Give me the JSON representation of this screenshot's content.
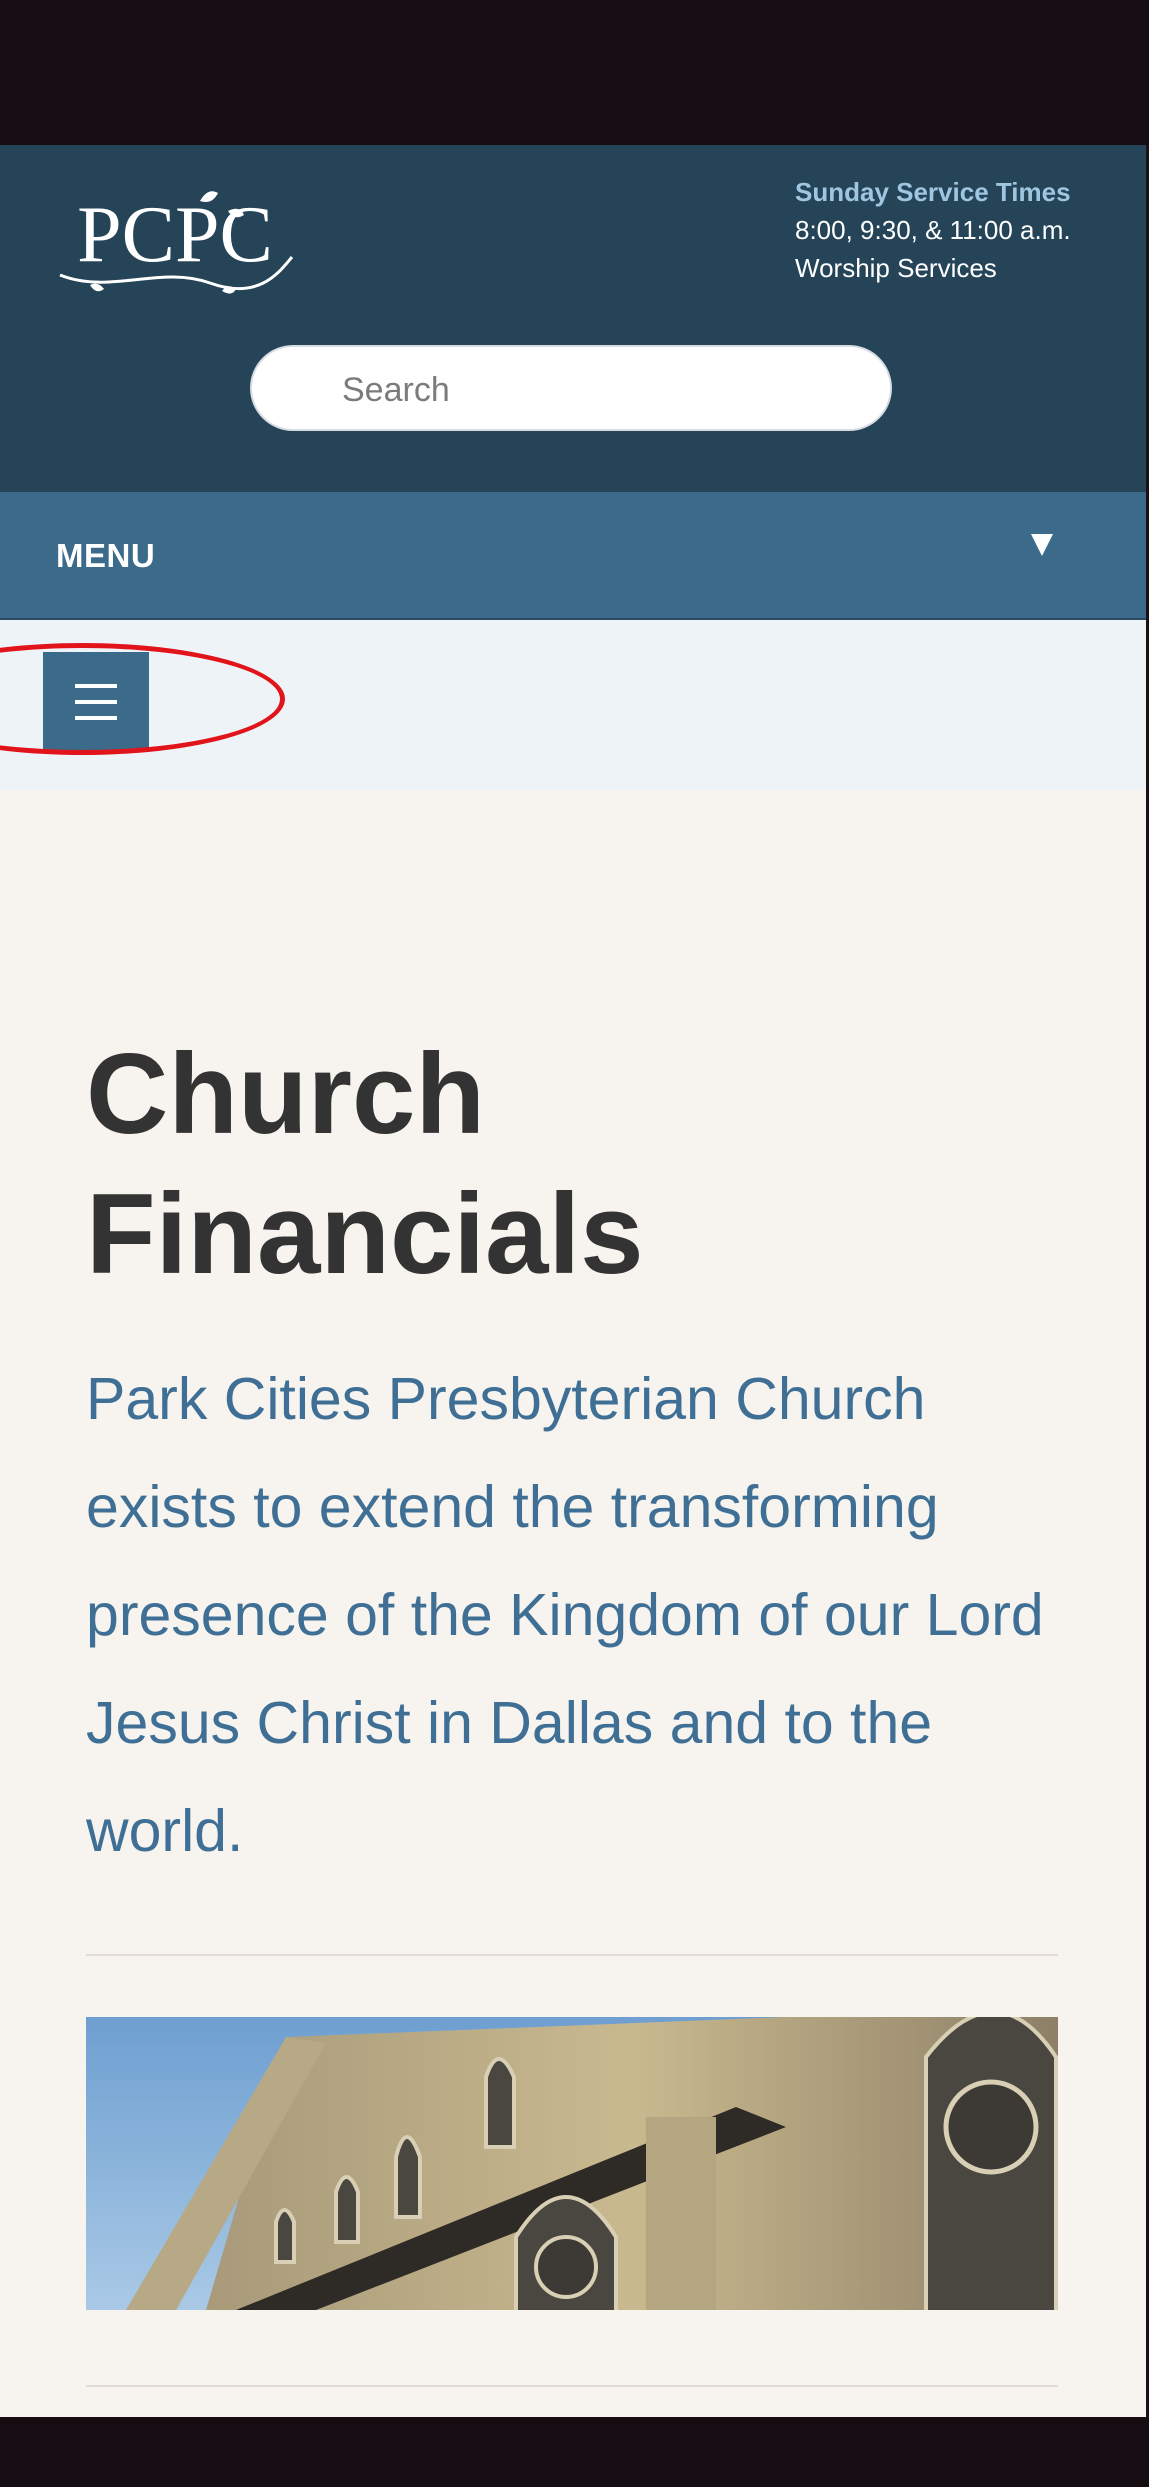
{
  "header": {
    "logo_text": "PCPC",
    "service_title": "Sunday Service Times",
    "service_times": "8:00, 9:30, & 11:00 a.m.",
    "service_label": "Worship Services"
  },
  "search": {
    "placeholder": "Search"
  },
  "menu": {
    "label": "MENU"
  },
  "page": {
    "title": "Church Financials",
    "intro": "Park Cities Presbyterian Church exists to extend the transforming presence of the Kingdom of our Lord Jesus Christ in Dallas and to the world."
  },
  "colors": {
    "header_bg": "#254458",
    "menu_bg": "#3b6a8a",
    "accent_text": "#3f6f95",
    "highlight": "#e2141b"
  }
}
